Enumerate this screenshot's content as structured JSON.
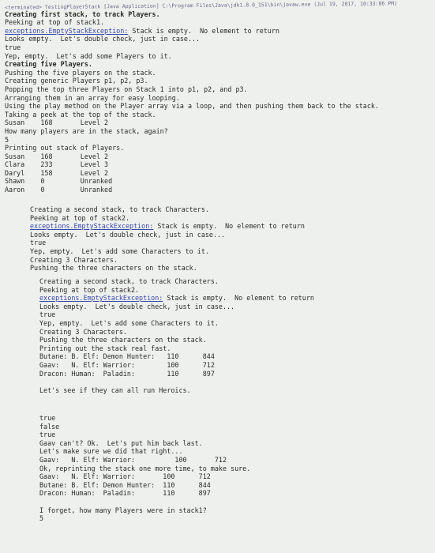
{
  "header": {
    "path": "<terminated> TestingPlayerStack [Java Application] C:\\Program Files\\Java\\jdk1.8.0_151\\bin\\javaw.exe (Jul 19, 2017, 10:33:06 PM)"
  },
  "block1": [
    {
      "t": "Creating first stack, to track Players.",
      "b": true
    },
    {
      "t": "Peeking at top of stack1."
    },
    {
      "pre": "exceptions.EmptyStackException:",
      "t": " Stack is empty.  No element to return"
    },
    {
      "t": "Looks empty.  Let's double check, just in case..."
    },
    {
      "t": "true"
    },
    {
      "t": "Yep, empty.  Let's add some Players to it."
    },
    {
      "t": "Creating five Players.",
      "b": true
    },
    {
      "t": "Pushing the five players on the stack."
    },
    {
      "t": "Creating generic Players p1, p2, p3."
    },
    {
      "t": "Popping the top three Players on Stack 1 into p1, p2, and p3."
    },
    {
      "t": "Arranging them in an array for easy looping."
    },
    {
      "t": "Using the play method on the Player array via a loop, and then pushing them back to the stack."
    },
    {
      "t": "Taking a peek at the top of the stack."
    },
    {
      "t": "Susan    168       Level 2"
    },
    {
      "t": "How many players are in the stack, again?"
    },
    {
      "t": "5"
    },
    {
      "t": "Printing out stack of Players."
    },
    {
      "t": "Susan    168       Level 2"
    },
    {
      "t": "Clara    233       Level 3"
    },
    {
      "t": "Daryl    158       Level 2"
    },
    {
      "t": "Shawn    0         Unranked"
    },
    {
      "t": "Aaron    0         Unranked"
    }
  ],
  "block2": [
    {
      "t": "Creating a second stack, to track Characters."
    },
    {
      "t": "Peeking at top of stack2."
    },
    {
      "pre": "exceptions.EmptyStackException:",
      "t": " Stack is empty.  No element to return"
    },
    {
      "t": "Looks empty.  Let's double check, just in case..."
    },
    {
      "t": "true"
    },
    {
      "t": "Yep, empty.  Let's add some Characters to it."
    },
    {
      "t": "Creating 3 Characters."
    },
    {
      "t": "Pushing the three characters on the stack."
    }
  ],
  "block3": [
    {
      "t": "Creating a second stack, to track Characters."
    },
    {
      "t": "Peeking at top of stack2."
    },
    {
      "pre": "exceptions.EmptyStackException:",
      "t": " Stack is empty.  No element to return"
    },
    {
      "t": "Looks empty.  Let's double check, just in case..."
    },
    {
      "t": "true"
    },
    {
      "t": "Yep, empty.  Let's add some Characters to it."
    },
    {
      "t": "Creating 3 Characters."
    },
    {
      "t": "Pushing the three characters on the stack."
    },
    {
      "t": "Printing out the stack real fast."
    },
    {
      "t": "Butane: B. Elf: Demon Hunter:   110      844"
    },
    {
      "t": "Gaav:   N. Elf: Warrior:        100      712"
    },
    {
      "t": "Dracon: Human:  Paladin:        110      897"
    },
    {
      "t": ""
    },
    {
      "t": "Let's see if they can all run Heroics."
    }
  ],
  "block4": [
    {
      "t": "true"
    },
    {
      "t": "false"
    },
    {
      "t": "true"
    },
    {
      "t": "Gaav can't? Ok.  Let's put him back last."
    },
    {
      "t": "Let's make sure we did that right..."
    },
    {
      "t": "Gaav:   N. Elf: Warrior:          100       712"
    },
    {
      "t": "Ok, reprinting the stack one more time, to make sure."
    },
    {
      "t": "Gaav:   N. Elf: Warrior:       100      712"
    },
    {
      "t": "Butane: B. Elf: Demon Hunter:  110      844"
    },
    {
      "t": "Dracon: Human:  Paladin:       110      897"
    },
    {
      "t": ""
    },
    {
      "t": "I forget, how many Players were in stack1?"
    },
    {
      "t": "5"
    }
  ]
}
